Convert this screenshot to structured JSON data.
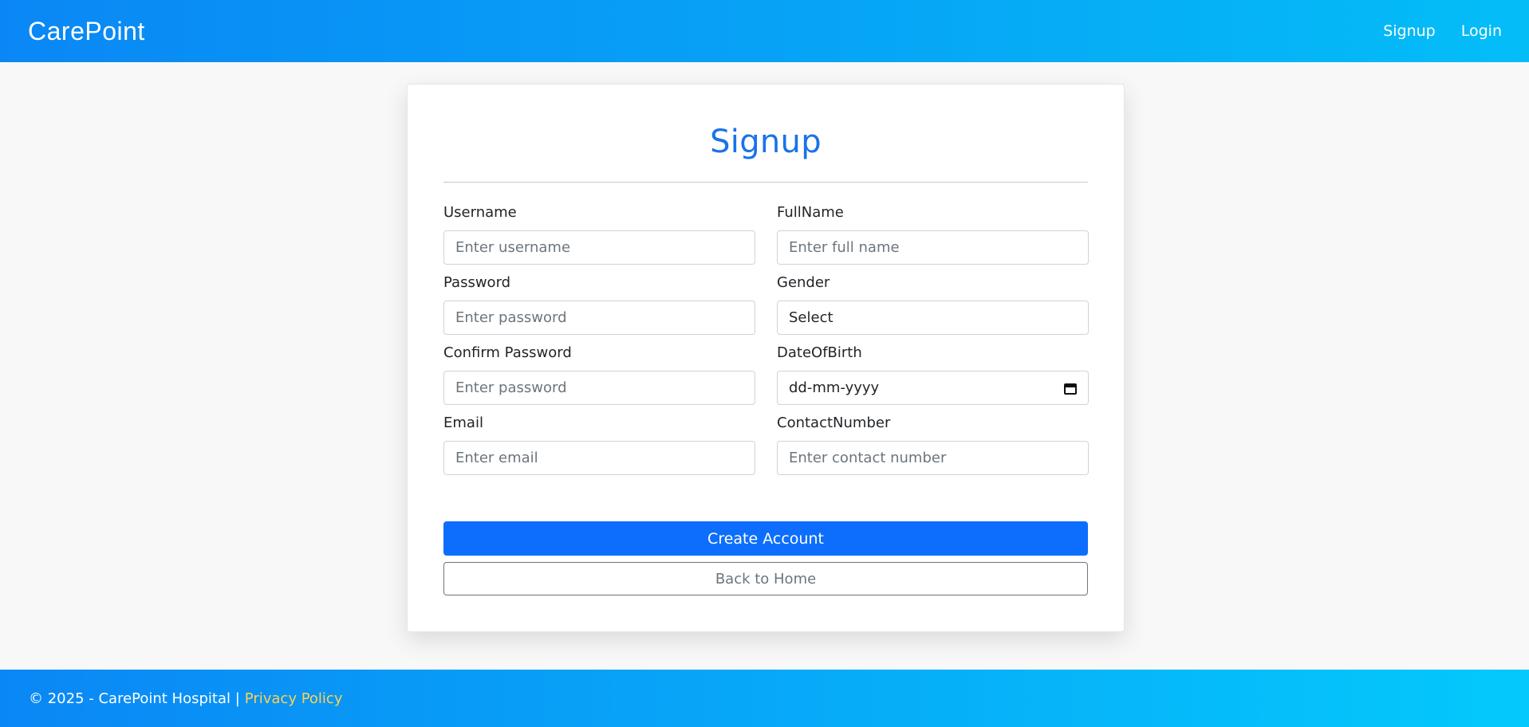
{
  "navbar": {
    "brand": "CarePoint",
    "links": [
      {
        "label": "Signup"
      },
      {
        "label": "Login"
      }
    ]
  },
  "form": {
    "title": "Signup",
    "username": {
      "label": "Username",
      "placeholder": "Enter username"
    },
    "fullname": {
      "label": "FullName",
      "placeholder": "Enter full name"
    },
    "password": {
      "label": "Password",
      "placeholder": "Enter password"
    },
    "gender": {
      "label": "Gender",
      "selected": "Select"
    },
    "confirm_password": {
      "label": "Confirm Password",
      "placeholder": "Enter password"
    },
    "dob": {
      "label": "DateOfBirth",
      "value": "dd-mm-yyyy"
    },
    "email": {
      "label": "Email",
      "placeholder": "Enter email"
    },
    "contact": {
      "label": "ContactNumber",
      "placeholder": "Enter contact number"
    },
    "create_label": "Create Account",
    "back_label": "Back to Home"
  },
  "footer": {
    "text": "© 2025 - CarePoint Hospital |",
    "privacy_label": "Privacy Policy"
  },
  "colors": {
    "header_gradient_start": "#0a87f5",
    "header_gradient_end": "#04bdf7",
    "primary": "#0d6efd",
    "title": "#1a73e8",
    "footer_link": "#ffd24d"
  }
}
